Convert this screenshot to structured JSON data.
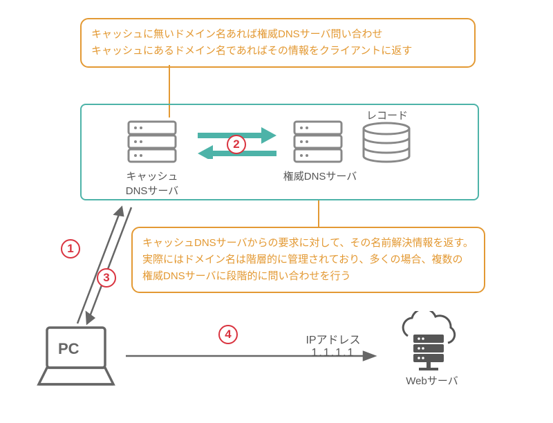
{
  "topBox": {
    "line1": "キャッシュに無いドメイン名あれば権威DNSサーバ問い合わせ",
    "line2": "キャッシュにあるドメイン名であればその情報をクライアントに返す"
  },
  "midBox": {
    "line1": "キャッシュDNSサーバからの要求に対して、その名前解決情報を返す。",
    "line2": "実際にはドメイン名は階層的に管理されており、多くの場合、複数の",
    "line3": "権威DNSサーバに段階的に問い合わせを行う"
  },
  "labels": {
    "cacheServer1": "キャッシュ",
    "cacheServer2": "DNSサーバ",
    "authServer": "権威DNSサーバ",
    "records": "レコード",
    "pc": "PC",
    "ipLabel": "IPアドレス",
    "ipValue": "1.1.1.1",
    "webServer": "Webサーバ"
  },
  "steps": {
    "s1": "1",
    "s2": "2",
    "s3": "3",
    "s4": "4"
  }
}
